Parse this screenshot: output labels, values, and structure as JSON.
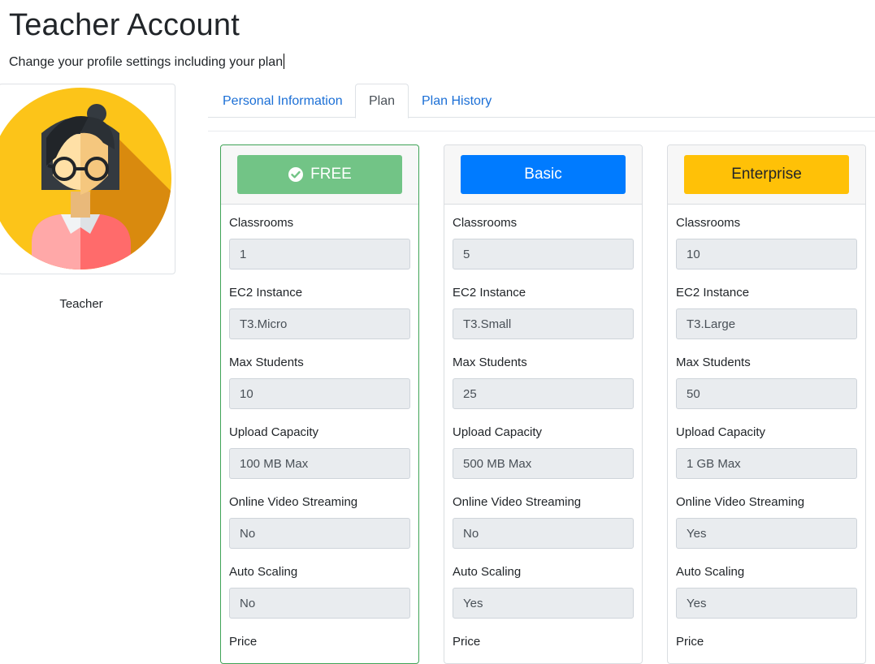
{
  "header": {
    "title": "Teacher Account",
    "subtitle": "Change your profile settings including your plan"
  },
  "profile": {
    "name": "Teacher"
  },
  "tabs": [
    {
      "label": "Personal Information",
      "active": false
    },
    {
      "label": "Plan",
      "active": true
    },
    {
      "label": "Plan History",
      "active": false
    }
  ],
  "colors": {
    "free": "#72c486",
    "basic": "#007bff",
    "enterprise": "#ffc107",
    "link": "#1b6fd6"
  },
  "plans": [
    {
      "button": "FREE",
      "selected": true,
      "icon": "check-circle-icon",
      "fields": [
        {
          "label": "Classrooms",
          "value": "1"
        },
        {
          "label": "EC2 Instance",
          "value": "T3.Micro"
        },
        {
          "label": "Max Students",
          "value": "10"
        },
        {
          "label": "Upload Capacity",
          "value": "100 MB Max"
        },
        {
          "label": "Online Video Streaming",
          "value": "No"
        },
        {
          "label": "Auto Scaling",
          "value": "No"
        },
        {
          "label": "Price",
          "value": ""
        }
      ]
    },
    {
      "button": "Basic",
      "selected": false,
      "fields": [
        {
          "label": "Classrooms",
          "value": "5"
        },
        {
          "label": "EC2 Instance",
          "value": "T3.Small"
        },
        {
          "label": "Max Students",
          "value": "25"
        },
        {
          "label": "Upload Capacity",
          "value": "500 MB Max"
        },
        {
          "label": "Online Video Streaming",
          "value": "No"
        },
        {
          "label": "Auto Scaling",
          "value": "Yes"
        },
        {
          "label": "Price",
          "value": ""
        }
      ]
    },
    {
      "button": "Enterprise",
      "selected": false,
      "fields": [
        {
          "label": "Classrooms",
          "value": "10"
        },
        {
          "label": "EC2 Instance",
          "value": "T3.Large"
        },
        {
          "label": "Max Students",
          "value": "50"
        },
        {
          "label": "Upload Capacity",
          "value": "1 GB Max"
        },
        {
          "label": "Online Video Streaming",
          "value": "Yes"
        },
        {
          "label": "Auto Scaling",
          "value": "Yes"
        },
        {
          "label": "Price",
          "value": ""
        }
      ]
    }
  ]
}
